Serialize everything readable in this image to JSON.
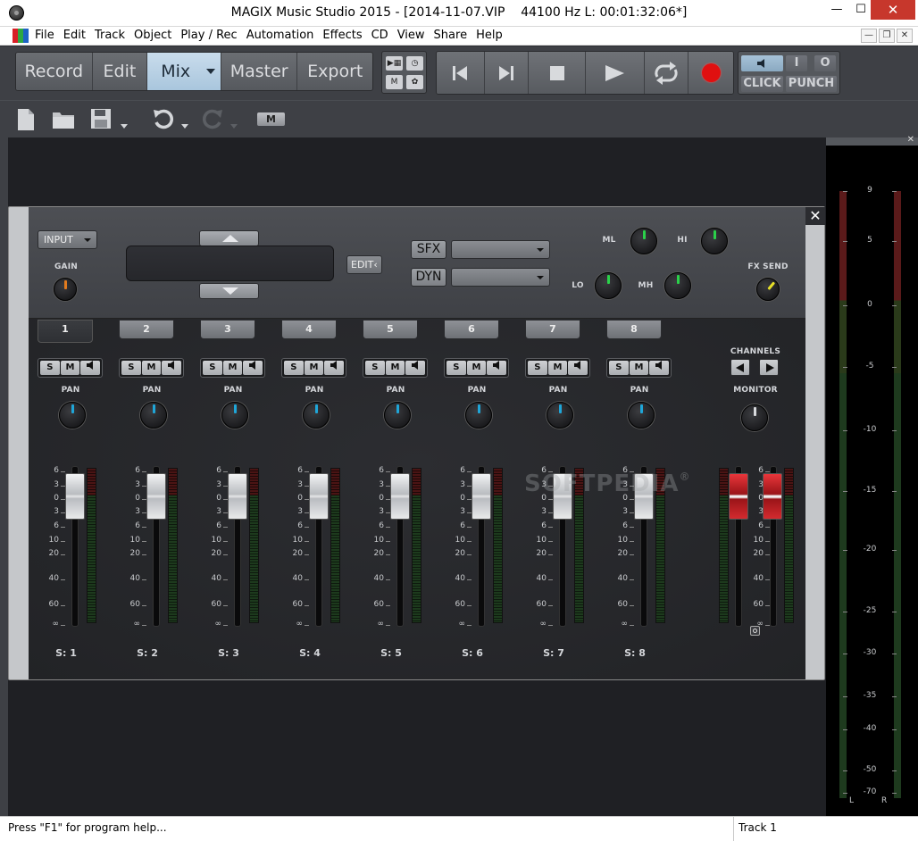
{
  "window": {
    "title": "MAGIX Music Studio 2015 - [2014-11-07.VIP    44100 Hz L: 00:01:32:06*]",
    "min_label": "—",
    "max_label": "☐",
    "close_label": "✕"
  },
  "menu": {
    "items": [
      "File",
      "Edit",
      "Track",
      "Object",
      "Play / Rec",
      "Automation",
      "Effects",
      "CD",
      "View",
      "Share",
      "Help"
    ],
    "mdi": [
      "—",
      "❐",
      "✕"
    ]
  },
  "nav": {
    "tabs": [
      {
        "label": "Record"
      },
      {
        "label": "Edit"
      },
      {
        "label": "Mix",
        "active": true
      },
      {
        "label": "Master"
      },
      {
        "label": "Export"
      }
    ]
  },
  "transport": {
    "click_label": "CLICK",
    "punch_label": "PUNCH",
    "i_label": "I",
    "o_label": "O"
  },
  "toolbar2": {
    "m_label": "M"
  },
  "mixer": {
    "input_label": "INPUT",
    "gain_label": "GAIN",
    "edit_label": "EDIT‹",
    "sfx_label": "SFX",
    "dyn_label": "DYN",
    "ml_label": "ML",
    "hi_label": "HI",
    "lo_label": "LO",
    "mh_label": "MH",
    "fx_send_label": "FX SEND",
    "channels_label": "CHANNELS",
    "monitor_label": "MONITOR",
    "pan_label": "PAN",
    "solo": "S",
    "mute": "M",
    "channels": [
      {
        "tab": "1",
        "label": "S:  1"
      },
      {
        "tab": "2",
        "label": "S:  2"
      },
      {
        "tab": "3",
        "label": "S:  3"
      },
      {
        "tab": "4",
        "label": "S:  4"
      },
      {
        "tab": "5",
        "label": "S:  5"
      },
      {
        "tab": "6",
        "label": "S:  6"
      },
      {
        "tab": "7",
        "label": "S:  7"
      },
      {
        "tab": "8",
        "label": "S:  8"
      }
    ],
    "scale": [
      "6",
      "3",
      "0",
      "3",
      "6",
      "10",
      "20",
      "40",
      "60",
      "∞"
    ],
    "watermark": "SOFTPEDIA",
    "watermark_mark": "®"
  },
  "master_meter": {
    "close": "✕",
    "ticks": [
      "9",
      "5",
      "0",
      "-5",
      "-10",
      "-15",
      "-20",
      "-25",
      "-30",
      "-35",
      "-40",
      "-50",
      "-70"
    ],
    "left": "L",
    "right": "R"
  },
  "status": {
    "help": "Press \"F1\" for program help...",
    "track": "Track 1"
  },
  "colors": {
    "accent": "#a9c6dd",
    "record": "#e01010",
    "knob_green": "#2bd14a",
    "knob_blue": "#1fa6d8",
    "knob_orange": "#e27b1e",
    "knob_yellow": "#e6e028"
  }
}
